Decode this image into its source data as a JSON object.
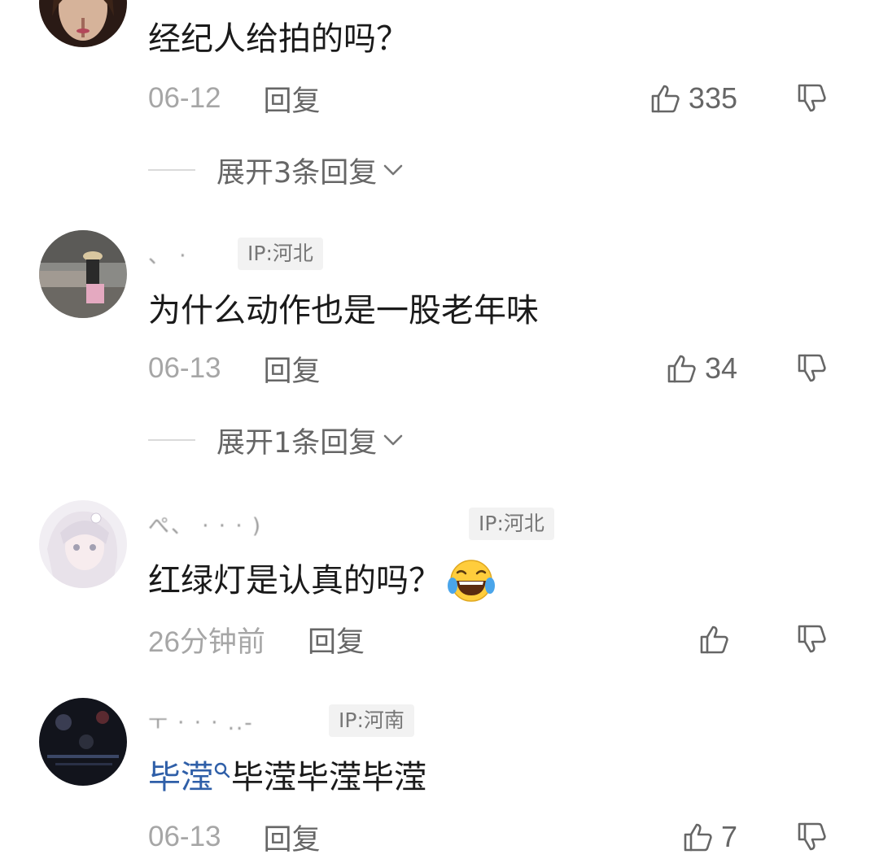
{
  "comments": [
    {
      "username": "",
      "ip": "",
      "text": "经纪人给拍的吗？",
      "date": "06-12",
      "reply_label": "回复",
      "likes": "335",
      "expand_label": "展开3条回复"
    },
    {
      "username": "、   ·",
      "ip": "IP:河北",
      "text": "为什么动作也是一股老年味",
      "date": "06-13",
      "reply_label": "回复",
      "likes": "34",
      "expand_label": "展开1条回复"
    },
    {
      "username": "ぺ、 ·  ·  ·      )",
      "ip": "IP:河北",
      "text": "红绿灯是认真的吗？",
      "emoji": "laughing-crying-emoji",
      "date": "26分钟前",
      "reply_label": "回复",
      "likes": ""
    },
    {
      "username": "ㅜ ·  ·  ·  ..-",
      "ip": "IP:河南",
      "hashtag": "毕滢",
      "text": "毕滢毕滢毕滢",
      "date": "06-13",
      "reply_label": "回复",
      "likes": "7"
    }
  ],
  "colors": {
    "hashtag": "#2f5fa8",
    "meta": "#a6a6a6",
    "ip_bg": "#f2f2f2"
  }
}
